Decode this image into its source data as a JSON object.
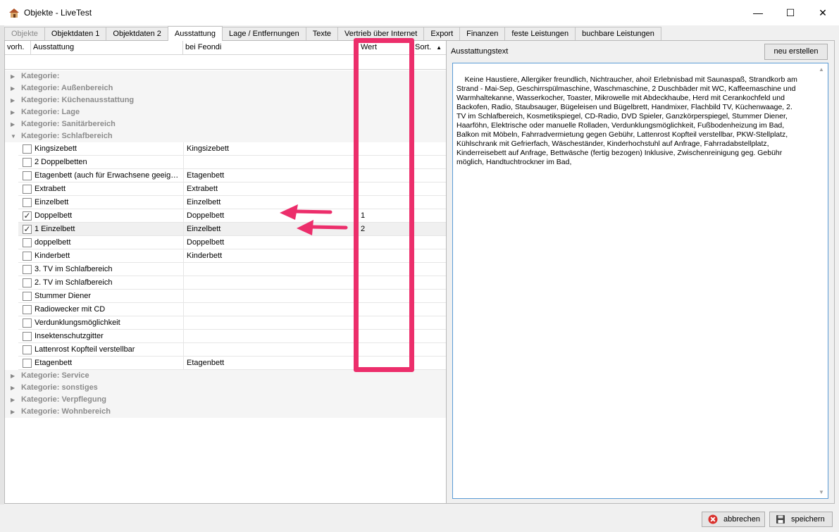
{
  "window": {
    "title": "Objekte - LiveTest",
    "controls": {
      "minimize": "—",
      "maximize": "☐",
      "close": "✕"
    }
  },
  "tabs": [
    {
      "label": "Objekte",
      "state": "disabled"
    },
    {
      "label": "Objektdaten 1",
      "state": "normal"
    },
    {
      "label": "Objektdaten 2",
      "state": "normal"
    },
    {
      "label": "Ausstattung",
      "state": "active"
    },
    {
      "label": "Lage / Entfernungen",
      "state": "normal"
    },
    {
      "label": "Texte",
      "state": "normal"
    },
    {
      "label": "Vertrieb über Internet",
      "state": "normal"
    },
    {
      "label": "Export",
      "state": "normal"
    },
    {
      "label": "Finanzen",
      "state": "normal"
    },
    {
      "label": "feste Leistungen",
      "state": "normal"
    },
    {
      "label": "buchbare Leistungen",
      "state": "normal"
    }
  ],
  "grid": {
    "columns": {
      "vorh": "vorh.",
      "ausstattung": "Ausstattung",
      "bei_feondi": "bei Feondi",
      "wert": "Wert",
      "sort": "Sort."
    },
    "categories_top": [
      "Kategorie:",
      "Kategorie: Außenbereich",
      "Kategorie: Küchenausstattung",
      "Kategorie: Lage",
      "Kategorie: Sanitärbereich",
      "Kategorie: Schlafbereich"
    ],
    "rows": [
      {
        "checked": false,
        "name": "Kingsizebett",
        "feondi": "Kingsizebett",
        "wert": ""
      },
      {
        "checked": false,
        "name": "2 Doppelbetten",
        "feondi": "",
        "wert": ""
      },
      {
        "checked": false,
        "name": "Etagenbett (auch für Erwachsene geeign...",
        "feondi": "Etagenbett",
        "wert": ""
      },
      {
        "checked": false,
        "name": "Extrabett",
        "feondi": "Extrabett",
        "wert": ""
      },
      {
        "checked": false,
        "name": "Einzelbett",
        "feondi": "Einzelbett",
        "wert": ""
      },
      {
        "checked": true,
        "name": "Doppelbett",
        "feondi": "Doppelbett",
        "wert": "1"
      },
      {
        "checked": true,
        "name": "1 Einzelbett",
        "feondi": "Einzelbett",
        "wert": "2"
      },
      {
        "checked": false,
        "name": "doppelbett",
        "feondi": "Doppelbett",
        "wert": ""
      },
      {
        "checked": false,
        "name": "Kinderbett",
        "feondi": "Kinderbett",
        "wert": ""
      },
      {
        "checked": false,
        "name": "3. TV im Schlafbereich",
        "feondi": "",
        "wert": ""
      },
      {
        "checked": false,
        "name": "2. TV im Schlafbereich",
        "feondi": "",
        "wert": ""
      },
      {
        "checked": false,
        "name": "Stummer Diener",
        "feondi": "",
        "wert": ""
      },
      {
        "checked": false,
        "name": "Radiowecker mit CD",
        "feondi": "",
        "wert": ""
      },
      {
        "checked": false,
        "name": "Verdunklungsmöglichkeit",
        "feondi": "",
        "wert": ""
      },
      {
        "checked": false,
        "name": "Insektenschutzgitter",
        "feondi": "",
        "wert": ""
      },
      {
        "checked": false,
        "name": "Lattenrost Kopfteil verstellbar",
        "feondi": "",
        "wert": ""
      },
      {
        "checked": false,
        "name": "Etagenbett",
        "feondi": "Etagenbett",
        "wert": ""
      }
    ],
    "categories_bottom": [
      "Kategorie: Service",
      "Kategorie: sonstiges",
      "Kategorie: Verpflegung",
      "Kategorie: Wohnbereich"
    ]
  },
  "right": {
    "label": "Ausstattungstext",
    "new_button": "neu erstellen",
    "text": "Keine Haustiere, Allergiker freundlich, Nichtraucher, ahoi! Erlebnisbad mit Saunaspaß, Strandkorb am\nStrand - Mai-Sep, Geschirrspülmaschine, Waschmaschine, 2 Duschbäder mit WC, Kaffeemaschine und\nWarmhaltekanne, Wasserkocher, Toaster, Mikrowelle mit Abdeckhaube, Herd mit Cerankochfeld und\nBackofen, Radio, Staubsauger, Bügeleisen und Bügelbrett, Handmixer, Flachbild TV, Küchenwaage, 2.\nTV im Schlafbereich, Kosmetikspiegel, CD-Radio, DVD Spieler, Ganzkörperspiegel, Stummer Diener,\nHaarföhn, Elektrische oder manuelle Rolladen, Verdunklungsmöglichkeit, Fußbodenheizung im Bad,\nBalkon mit Möbeln, Fahrradvermietung gegen Gebühr, Lattenrost Kopfteil verstellbar, PKW-Stellplatz,\nKühlschrank mit Gefrierfach, Wäscheständer, Kinderhochstuhl auf Anfrage, Fahrradabstellplatz,\nKinderreisebett auf Anfrage, Bettwäsche (fertig bezogen) Inklusive, Zwischenreinigung geg. Gebühr\nmöglich, Handtuchtrockner im Bad,"
  },
  "footer": {
    "cancel": "abbrechen",
    "save": "speichern"
  },
  "colors": {
    "annotation": "#ec2e6b",
    "textbox_border": "#5a9bd5"
  }
}
